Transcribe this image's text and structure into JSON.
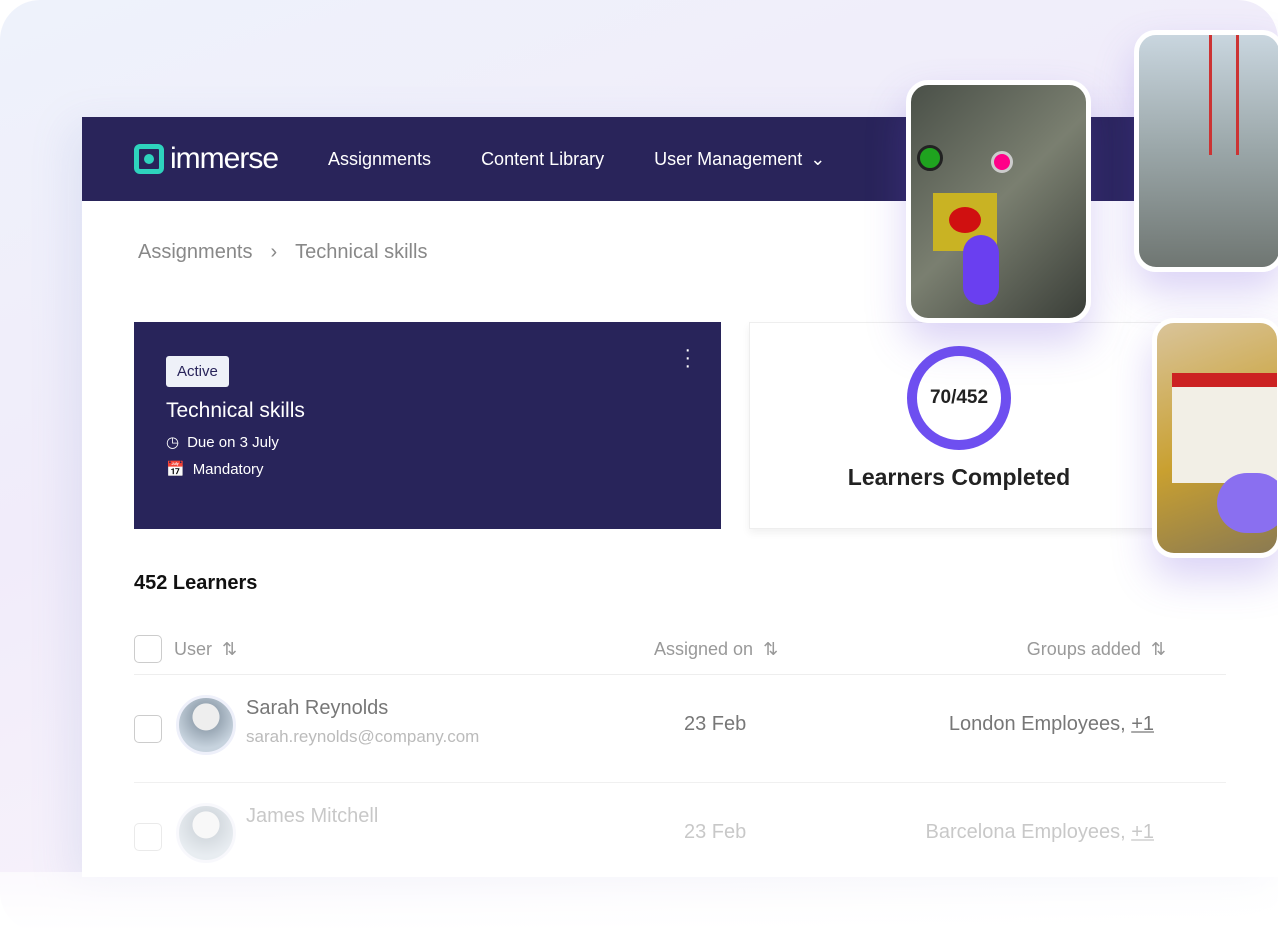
{
  "nav": {
    "brand": "immerse",
    "items": [
      "Assignments",
      "Content Library",
      "User Management"
    ]
  },
  "breadcrumb": [
    "Assignments",
    "Technical skills"
  ],
  "assignment": {
    "status": "Active",
    "title": "Technical skills",
    "due": "Due on 3 July",
    "type": "Mandatory"
  },
  "stats": {
    "completed": "70/452",
    "completed_fraction": 0.155,
    "label": "Learners Completed"
  },
  "learners": {
    "count_label": "452 Learners",
    "columns": [
      "User",
      "Assigned on",
      "Groups added"
    ],
    "rows": [
      {
        "name": "Sarah Reynolds",
        "email": "sarah.reynolds@company.com",
        "assigned": "23 Feb",
        "groups": "London Employees, ",
        "more": "+1"
      },
      {
        "name": "James Mitchell",
        "email": "",
        "assigned": "23 Feb",
        "groups": "Barcelona Employees, ",
        "more": "+1"
      }
    ]
  },
  "colors": {
    "nav": "#29245a",
    "accent": "#6e4ff0",
    "logo": "#2ed3bd"
  }
}
